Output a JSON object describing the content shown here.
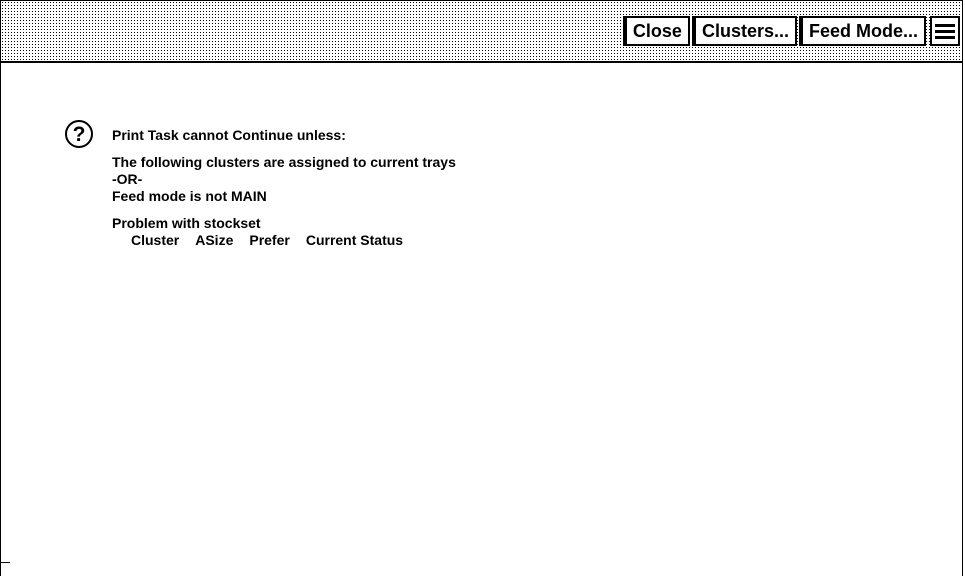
{
  "toolbar": {
    "close_label": "Close",
    "clusters_label": "Clusters...",
    "feed_mode_label": "Feed Mode...",
    "menu_icon": "hamburger-menu-icon"
  },
  "message": {
    "icon": "question-icon",
    "title": "Print Task cannot Continue unless:",
    "condition_lines": [
      "The following clusters are assigned to current trays",
      "-OR-",
      "Feed mode is not MAIN"
    ],
    "problem_heading": "Problem with stockset",
    "table_headers": [
      "Cluster",
      "ASize",
      "Prefer",
      "Current Status"
    ]
  }
}
